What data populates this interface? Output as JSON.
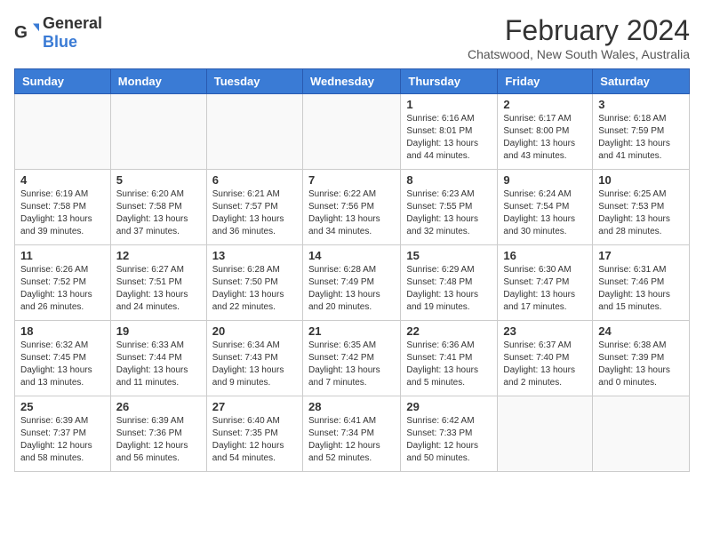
{
  "logo": {
    "general": "General",
    "blue": "Blue"
  },
  "title": "February 2024",
  "subtitle": "Chatswood, New South Wales, Australia",
  "days_of_week": [
    "Sunday",
    "Monday",
    "Tuesday",
    "Wednesday",
    "Thursday",
    "Friday",
    "Saturday"
  ],
  "weeks": [
    [
      {
        "day": "",
        "info": ""
      },
      {
        "day": "",
        "info": ""
      },
      {
        "day": "",
        "info": ""
      },
      {
        "day": "",
        "info": ""
      },
      {
        "day": "1",
        "info": "Sunrise: 6:16 AM\nSunset: 8:01 PM\nDaylight: 13 hours and 44 minutes."
      },
      {
        "day": "2",
        "info": "Sunrise: 6:17 AM\nSunset: 8:00 PM\nDaylight: 13 hours and 43 minutes."
      },
      {
        "day": "3",
        "info": "Sunrise: 6:18 AM\nSunset: 7:59 PM\nDaylight: 13 hours and 41 minutes."
      }
    ],
    [
      {
        "day": "4",
        "info": "Sunrise: 6:19 AM\nSunset: 7:58 PM\nDaylight: 13 hours and 39 minutes."
      },
      {
        "day": "5",
        "info": "Sunrise: 6:20 AM\nSunset: 7:58 PM\nDaylight: 13 hours and 37 minutes."
      },
      {
        "day": "6",
        "info": "Sunrise: 6:21 AM\nSunset: 7:57 PM\nDaylight: 13 hours and 36 minutes."
      },
      {
        "day": "7",
        "info": "Sunrise: 6:22 AM\nSunset: 7:56 PM\nDaylight: 13 hours and 34 minutes."
      },
      {
        "day": "8",
        "info": "Sunrise: 6:23 AM\nSunset: 7:55 PM\nDaylight: 13 hours and 32 minutes."
      },
      {
        "day": "9",
        "info": "Sunrise: 6:24 AM\nSunset: 7:54 PM\nDaylight: 13 hours and 30 minutes."
      },
      {
        "day": "10",
        "info": "Sunrise: 6:25 AM\nSunset: 7:53 PM\nDaylight: 13 hours and 28 minutes."
      }
    ],
    [
      {
        "day": "11",
        "info": "Sunrise: 6:26 AM\nSunset: 7:52 PM\nDaylight: 13 hours and 26 minutes."
      },
      {
        "day": "12",
        "info": "Sunrise: 6:27 AM\nSunset: 7:51 PM\nDaylight: 13 hours and 24 minutes."
      },
      {
        "day": "13",
        "info": "Sunrise: 6:28 AM\nSunset: 7:50 PM\nDaylight: 13 hours and 22 minutes."
      },
      {
        "day": "14",
        "info": "Sunrise: 6:28 AM\nSunset: 7:49 PM\nDaylight: 13 hours and 20 minutes."
      },
      {
        "day": "15",
        "info": "Sunrise: 6:29 AM\nSunset: 7:48 PM\nDaylight: 13 hours and 19 minutes."
      },
      {
        "day": "16",
        "info": "Sunrise: 6:30 AM\nSunset: 7:47 PM\nDaylight: 13 hours and 17 minutes."
      },
      {
        "day": "17",
        "info": "Sunrise: 6:31 AM\nSunset: 7:46 PM\nDaylight: 13 hours and 15 minutes."
      }
    ],
    [
      {
        "day": "18",
        "info": "Sunrise: 6:32 AM\nSunset: 7:45 PM\nDaylight: 13 hours and 13 minutes."
      },
      {
        "day": "19",
        "info": "Sunrise: 6:33 AM\nSunset: 7:44 PM\nDaylight: 13 hours and 11 minutes."
      },
      {
        "day": "20",
        "info": "Sunrise: 6:34 AM\nSunset: 7:43 PM\nDaylight: 13 hours and 9 minutes."
      },
      {
        "day": "21",
        "info": "Sunrise: 6:35 AM\nSunset: 7:42 PM\nDaylight: 13 hours and 7 minutes."
      },
      {
        "day": "22",
        "info": "Sunrise: 6:36 AM\nSunset: 7:41 PM\nDaylight: 13 hours and 5 minutes."
      },
      {
        "day": "23",
        "info": "Sunrise: 6:37 AM\nSunset: 7:40 PM\nDaylight: 13 hours and 2 minutes."
      },
      {
        "day": "24",
        "info": "Sunrise: 6:38 AM\nSunset: 7:39 PM\nDaylight: 13 hours and 0 minutes."
      }
    ],
    [
      {
        "day": "25",
        "info": "Sunrise: 6:39 AM\nSunset: 7:37 PM\nDaylight: 12 hours and 58 minutes."
      },
      {
        "day": "26",
        "info": "Sunrise: 6:39 AM\nSunset: 7:36 PM\nDaylight: 12 hours and 56 minutes."
      },
      {
        "day": "27",
        "info": "Sunrise: 6:40 AM\nSunset: 7:35 PM\nDaylight: 12 hours and 54 minutes."
      },
      {
        "day": "28",
        "info": "Sunrise: 6:41 AM\nSunset: 7:34 PM\nDaylight: 12 hours and 52 minutes."
      },
      {
        "day": "29",
        "info": "Sunrise: 6:42 AM\nSunset: 7:33 PM\nDaylight: 12 hours and 50 minutes."
      },
      {
        "day": "",
        "info": ""
      },
      {
        "day": "",
        "info": ""
      }
    ]
  ]
}
